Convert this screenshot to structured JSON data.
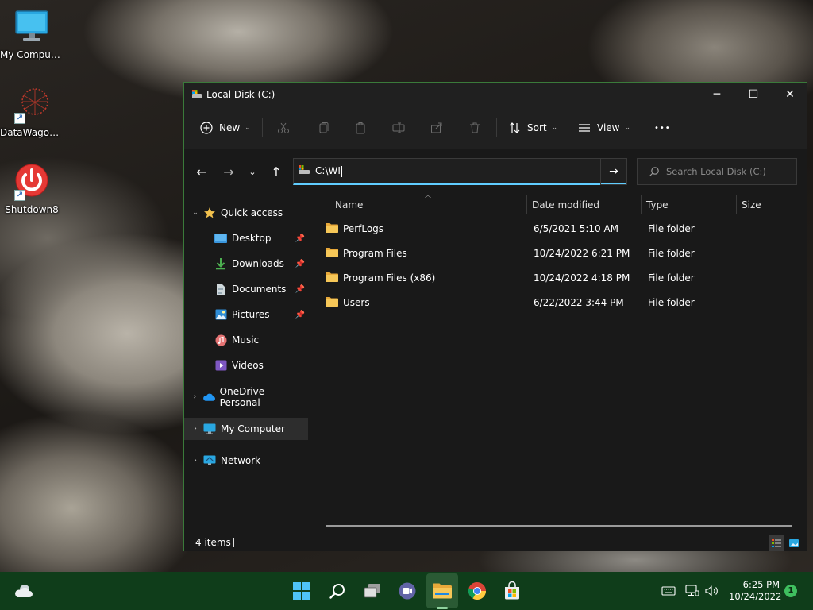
{
  "desktop": {
    "icons": [
      {
        "label": "My Computer"
      },
      {
        "label": "DataWagon..."
      },
      {
        "label": "Shutdown8"
      }
    ]
  },
  "window": {
    "title": "Local Disk (C:)",
    "controls": {
      "minimize": "─",
      "maximize": "☐",
      "close": "✕"
    }
  },
  "toolbar": {
    "new_label": "New",
    "sort_label": "Sort",
    "view_label": "View",
    "more_label": "•••"
  },
  "address": {
    "value": "C:\\WI",
    "search_placeholder": "Search Local Disk (C:)"
  },
  "sidebar": {
    "items": [
      {
        "label": "Quick access"
      },
      {
        "label": "Desktop"
      },
      {
        "label": "Downloads"
      },
      {
        "label": "Documents"
      },
      {
        "label": "Pictures"
      },
      {
        "label": "Music"
      },
      {
        "label": "Videos"
      },
      {
        "label": "OneDrive - Personal"
      },
      {
        "label": "My Computer"
      },
      {
        "label": "Network"
      }
    ]
  },
  "columns": {
    "name": "Name",
    "date": "Date modified",
    "type": "Type",
    "size": "Size"
  },
  "files": [
    {
      "name": "PerfLogs",
      "date": "6/5/2021 5:10 AM",
      "type": "File folder"
    },
    {
      "name": "Program Files",
      "date": "10/24/2022 6:21 PM",
      "type": "File folder"
    },
    {
      "name": "Program Files (x86)",
      "date": "10/24/2022 4:18 PM",
      "type": "File folder"
    },
    {
      "name": "Users",
      "date": "6/22/2022 3:44 PM",
      "type": "File folder"
    }
  ],
  "status": {
    "items_count": "4 items"
  },
  "taskbar": {
    "time": "6:25 PM",
    "date": "10/24/2022",
    "notification_count": "1"
  },
  "colors": {
    "accent": "#60cdff",
    "folder": "#f2c14e",
    "taskbar": "#0f3d1a",
    "window_border": "#3a7a3a"
  }
}
